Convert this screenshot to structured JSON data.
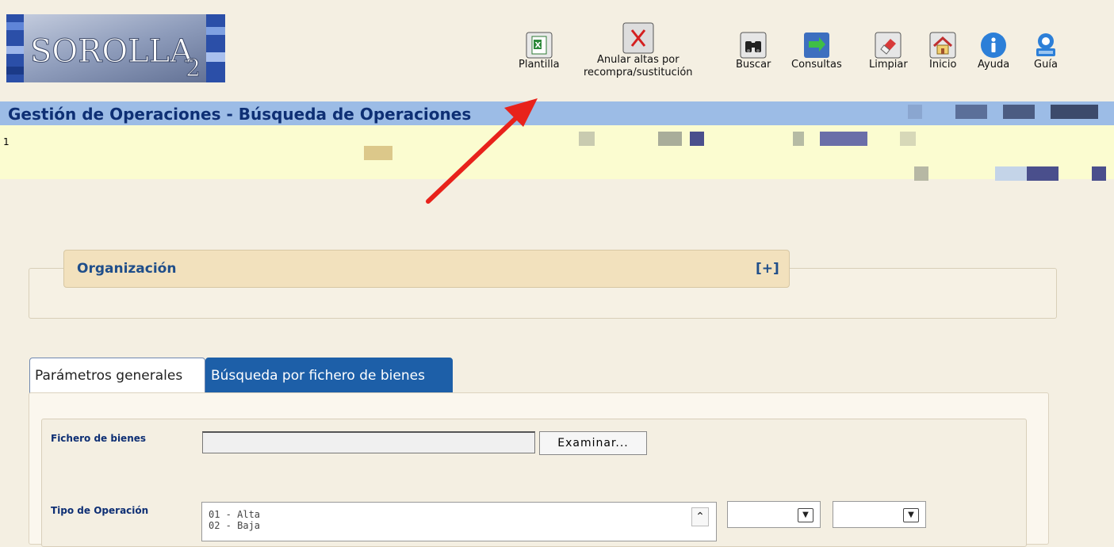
{
  "logo": {
    "text_main": "SOROLLA",
    "text_sub": "2"
  },
  "toolbar": {
    "plantilla": "Plantilla",
    "anular_line1": "Anular altas por",
    "anular_line2": "recompra/sustitución",
    "buscar": "Buscar",
    "consultas": "Consultas",
    "limpiar": "Limpiar",
    "inicio": "Inicio",
    "ayuda": "Ayuda",
    "guia": "Guía"
  },
  "header": {
    "title": "Gestión de Operaciones - Búsqueda de Operaciones"
  },
  "notice": {
    "number": "1"
  },
  "organization": {
    "title": "Organización",
    "toggle": "[+]"
  },
  "tabs": [
    {
      "label": "Parámetros generales",
      "active": false
    },
    {
      "label": "Búsqueda por fichero de bienes",
      "active": true
    }
  ],
  "form": {
    "fichero_label": "Fichero de bienes",
    "fichero_value": "",
    "browse_label": "Examinar...",
    "tipo_label": "Tipo de Operación",
    "tipo_options": [
      "01 - Alta",
      "02 - Baja"
    ]
  },
  "colors": {
    "title_bar": "#9cbce6",
    "title_text": "#0e2f74",
    "active_tab": "#1d5fa8",
    "org_header": "#f2e1bd",
    "annotation_arrow": "#e8221b"
  }
}
